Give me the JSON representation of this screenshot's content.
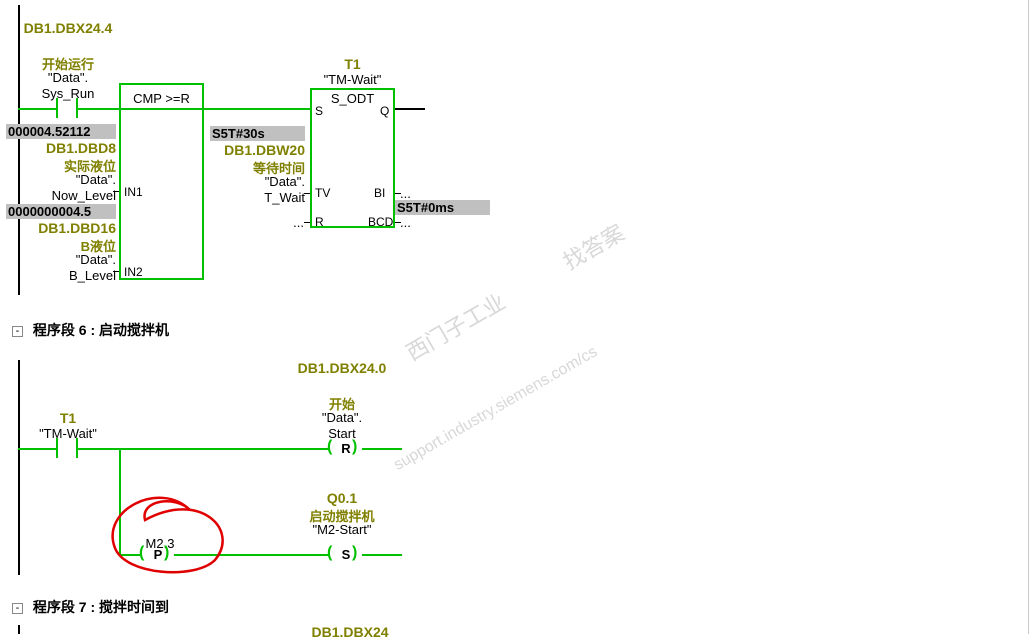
{
  "network5": {
    "contact1": {
      "addr": "DB1.DBX24.4",
      "cn": "开始运行",
      "sym1": "\"Data\".",
      "sym2": "Sys_Run"
    },
    "block_cmp": {
      "title": "CMP >=R",
      "in1_pin": "IN1",
      "in2_pin": "IN2",
      "in1": {
        "val": "000004.52112",
        "addr": "DB1.DBD8",
        "cn": "实际液位",
        "sym1": "\"Data\".",
        "sym2": "Now_Level"
      },
      "in2": {
        "val": "0000000004.5",
        "addr": "DB1.DBD16",
        "cn": "B液位",
        "sym1": "\"Data\".",
        "sym2": "B_Level"
      }
    },
    "block_timer": {
      "name": "T1",
      "sym": "\"TM-Wait\"",
      "type": "S_ODT",
      "s_pin": "S",
      "q_pin": "Q",
      "tv_pin": "TV",
      "bi_pin": "BI",
      "r_pin": "R",
      "bcd_pin": "BCD",
      "tv": {
        "val": "S5T#30s",
        "addr": "DB1.DBW20",
        "cn": "等待时间",
        "sym1": "\"Data\".",
        "sym2": "T_Wait"
      },
      "r_in": "...",
      "bi_out": "...",
      "bcd_out": "...",
      "q_val": "S5T#0ms"
    }
  },
  "section6": {
    "title": "程序段 6 : 启动搅拌机"
  },
  "network6": {
    "contact": {
      "name": "T1",
      "sym": "\"TM-Wait\""
    },
    "pulse": {
      "addr": "M2.3",
      "coil": "P"
    },
    "reset": {
      "addr": "DB1.DBX24.0",
      "cn": "开始",
      "sym1": "\"Data\".",
      "sym2": "Start",
      "coil": "R"
    },
    "set": {
      "addr": "Q0.1",
      "cn": "启动搅拌机",
      "sym": "\"M2-Start\"",
      "coil": "S"
    }
  },
  "section7": {
    "title": "程序段 7 : 搅拌时间到"
  },
  "network7": {
    "peek": "DB1.DBX24"
  },
  "watermark": {
    "t1": "西门子工业",
    "t2": "找答案",
    "t3": "support.industry.siemens.com/cs"
  }
}
